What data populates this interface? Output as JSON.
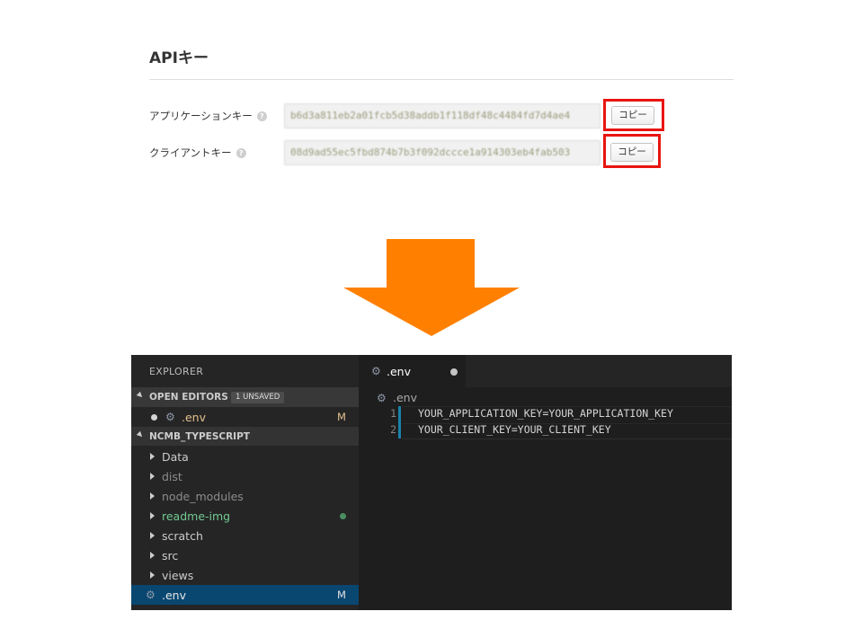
{
  "api_panel": {
    "title": "APIキー",
    "rows": [
      {
        "label": "アプリケーションキー",
        "value": "b6d3a811eb2a01fcb5d38addb1f118df48c4484fd7d4ae4",
        "copy_label": "コピー"
      },
      {
        "label": "クライアントキー",
        "value": "08d9ad55ec5fbd874b7b3f092dccce1a914303eb4fab503",
        "copy_label": "コピー"
      }
    ],
    "help_glyph": "?",
    "highlight_color": "#e8150f"
  },
  "arrow": {
    "color": "#ff8000",
    "direction": "down"
  },
  "vscode": {
    "explorer_title": "EXPLORER",
    "open_editors": {
      "label": "OPEN EDITORS",
      "badge": "1 UNSAVED",
      "items": [
        {
          "name": ".env",
          "status": "M"
        }
      ]
    },
    "project": {
      "label": "NCMB_TYPESCRIPT",
      "folders": [
        {
          "name": "Data"
        },
        {
          "name": "dist"
        },
        {
          "name": "node_modules"
        },
        {
          "name": "readme-img"
        },
        {
          "name": "scratch"
        },
        {
          "name": "src"
        },
        {
          "name": "views"
        }
      ],
      "files": [
        {
          "name": ".env",
          "status": "M"
        }
      ]
    },
    "tab": {
      "label": ".env"
    },
    "breadcrumb": ".env",
    "lines": [
      {
        "num": "1",
        "text": "YOUR_APPLICATION_KEY=YOUR_APPLICATION_KEY"
      },
      {
        "num": "2",
        "text": "YOUR_CLIENT_KEY=YOUR_CLIENT_KEY"
      }
    ],
    "icons": {
      "file": "gear-icon"
    }
  }
}
